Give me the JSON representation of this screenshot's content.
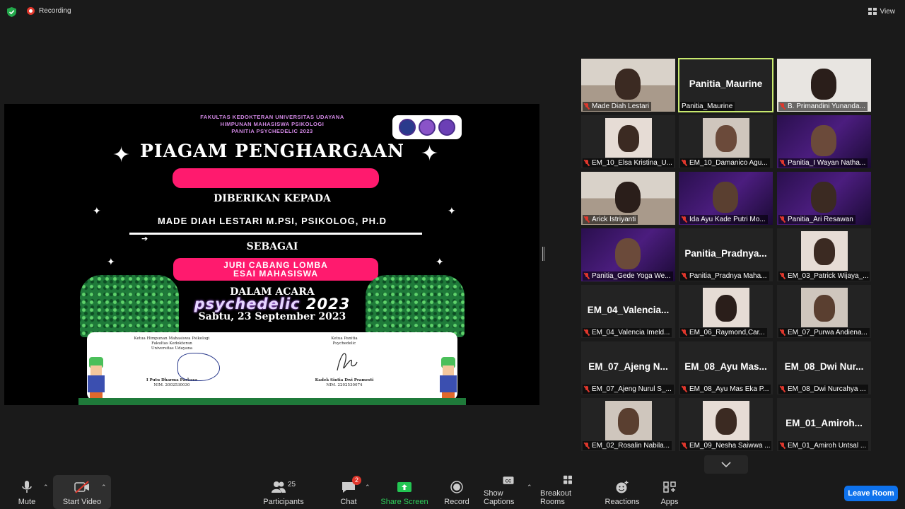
{
  "topbar": {
    "recording_label": "Recording",
    "view_label": "View"
  },
  "certificate": {
    "header_lines": [
      "FAKULTAS KEDOKTERAN UNIVERSITAS UDAYANA",
      "HIMPUNAN MAHASISWA PSIKOLOGI",
      "PANITIA PSYCHEDELIC 2023"
    ],
    "title": "PIAGAM PENGHARGAAN",
    "given_to": "DIBERIKAN KEPADA",
    "recipient": "MADE DIAH  LESTARI M.PSI, PSIKOLOG, PH.D",
    "as_label": "SEBAGAI",
    "role_line1": "JURI CABANG LOMBA",
    "role_line2": "ESAI MAHASISWA",
    "event_label": "DALAM ACARA",
    "event_wordmark": "psychedelic",
    "event_year": "2023",
    "event_date": "Sabtu, 23 September 2023",
    "signer_left": {
      "title_lines": [
        "Ketua Himpunan Mahasiswa Psikologi",
        "Fakultas Kedokteran",
        "Universitas Udayana"
      ],
      "name": "I Putu Dharma Parkasa",
      "nim": "NIM. 2002530030"
    },
    "signer_right": {
      "title_lines": [
        "Ketua Panitia",
        "Psychedelic"
      ],
      "name": "Kadek Sintia Dwi Pramesti",
      "nim": "NIM. 2202530074"
    }
  },
  "gallery": {
    "tiles": [
      {
        "label": "Made Diah Lestari",
        "big": "",
        "cam": "room"
      },
      {
        "label": "Panitia_Maurine",
        "big": "Panitia_Maurine",
        "cam": "none",
        "active": true
      },
      {
        "label": "B. Primandini Yunanda...",
        "big": "",
        "cam": "white"
      },
      {
        "label": "EM_10_Elsa Kristina_U...",
        "big": "",
        "cam": "thumb"
      },
      {
        "label": "EM_10_Damanico Agu...",
        "big": "",
        "cam": "thumb"
      },
      {
        "label": "Panitia_I Wayan Natha...",
        "big": "",
        "cam": "purple"
      },
      {
        "label": "Arick Istriyanti",
        "big": "",
        "cam": "room"
      },
      {
        "label": "Ida Ayu Kade Putri Mo...",
        "big": "",
        "cam": "purple"
      },
      {
        "label": "Panitia_Ari Resawan",
        "big": "",
        "cam": "purple"
      },
      {
        "label": "Panitia_Gede Yoga We...",
        "big": "",
        "cam": "purple"
      },
      {
        "label": "Panitia_Pradnya Maha...",
        "big": "Panitia_Pradnya...",
        "cam": "none"
      },
      {
        "label": "EM_03_Patrick Wijaya_...",
        "big": "",
        "cam": "thumb"
      },
      {
        "label": "EM_04_Valencia Imeld...",
        "big": "EM_04_Valencia...",
        "cam": "none"
      },
      {
        "label": "EM_06_Raymond,Car...",
        "big": "",
        "cam": "thumb"
      },
      {
        "label": "EM_07_Purwa Andiena...",
        "big": "",
        "cam": "thumb"
      },
      {
        "label": "EM_07_Ajeng Nurul S_...",
        "big": "EM_07_Ajeng  N...",
        "cam": "none"
      },
      {
        "label": "EM_08_Ayu Mas Eka P...",
        "big": "EM_08_Ayu  Mas...",
        "cam": "none"
      },
      {
        "label": "EM_08_Dwi Nurcahya ...",
        "big": "EM_08_Dwi  Nur...",
        "cam": "none"
      },
      {
        "label": "EM_02_Rosalin Nabila...",
        "big": "",
        "cam": "thumb"
      },
      {
        "label": "EM_09_Nesha Saiwwa ...",
        "big": "",
        "cam": "thumb"
      },
      {
        "label": "EM_01_Amiroh Untsal ...",
        "big": "EM_01_Amiroh...",
        "cam": "none"
      }
    ]
  },
  "toolbar": {
    "mute": "Mute",
    "start_video": "Start Video",
    "participants": "Participants",
    "participants_count": "25",
    "chat": "Chat",
    "chat_badge": "2",
    "share_screen": "Share Screen",
    "record": "Record",
    "captions": "Show Captions",
    "breakout": "Breakout Rooms",
    "reactions": "Reactions",
    "apps": "Apps",
    "leave": "Leave Room"
  },
  "colors": {
    "accent_pink": "#ff1a6e",
    "leave_blue": "#0e72ed",
    "share_green": "#2fd05b",
    "active_speaker": "#c8e96e"
  }
}
